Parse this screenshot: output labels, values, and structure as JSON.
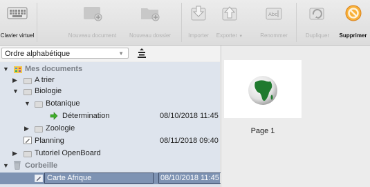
{
  "toolbar": {
    "items": [
      {
        "label": "Clavier virtuel",
        "icon": "keyboard-icon",
        "enabled": true
      },
      {
        "label": "Nouveau document",
        "icon": "new-document-icon",
        "enabled": false
      },
      {
        "label": "Nouveau dossier",
        "icon": "new-folder-icon",
        "enabled": false
      },
      {
        "label": "Importer",
        "icon": "import-icon",
        "enabled": false
      },
      {
        "label": "Exporter",
        "icon": "export-icon",
        "enabled": false
      },
      {
        "label": "Renommer",
        "icon": "rename-icon",
        "enabled": false
      },
      {
        "label": "Dupliquer",
        "icon": "duplicate-icon",
        "enabled": false
      },
      {
        "label": "Supprimer",
        "icon": "delete-icon",
        "enabled": true
      }
    ]
  },
  "sort": {
    "selected": "Ordre alphabétique",
    "direction_icon": "sort-descending-icon"
  },
  "tree": {
    "rows": [
      {
        "name": "Mes documents",
        "date": "",
        "toggle": "expanded",
        "icon": "documents-group-icon",
        "group": true
      },
      {
        "name": "A trier",
        "date": "",
        "toggle": "collapsed",
        "icon": "folder-icon"
      },
      {
        "name": "Biologie",
        "date": "",
        "toggle": "expanded",
        "icon": "folder-icon"
      },
      {
        "name": "Botanique",
        "date": "",
        "toggle": "expanded",
        "icon": "folder-icon"
      },
      {
        "name": "Détermination",
        "date": "08/10/2018 11:45",
        "toggle": "",
        "icon": "green-arrow-icon"
      },
      {
        "name": "Zoologie",
        "date": "",
        "toggle": "collapsed",
        "icon": "folder-icon"
      },
      {
        "name": "Planning",
        "date": "08/11/2018 09:40",
        "toggle": "",
        "icon": "document-icon"
      },
      {
        "name": "Tutoriel OpenBoard",
        "date": "",
        "toggle": "collapsed",
        "icon": "folder-icon"
      },
      {
        "name": "Corbeille",
        "date": "",
        "toggle": "expanded",
        "icon": "trash-icon",
        "group": true
      },
      {
        "name": "Carte Afrique",
        "date": "08/10/2018 11:45",
        "toggle": "",
        "icon": "document-icon",
        "selected": true
      }
    ]
  },
  "preview": {
    "page_label": "Page 1",
    "thumbnail": "africa-globe-icon"
  },
  "colors": {
    "tree_bg": "#dee4ed",
    "selection_bg": "#7e93b3",
    "accent_delete": "#f5a623"
  }
}
